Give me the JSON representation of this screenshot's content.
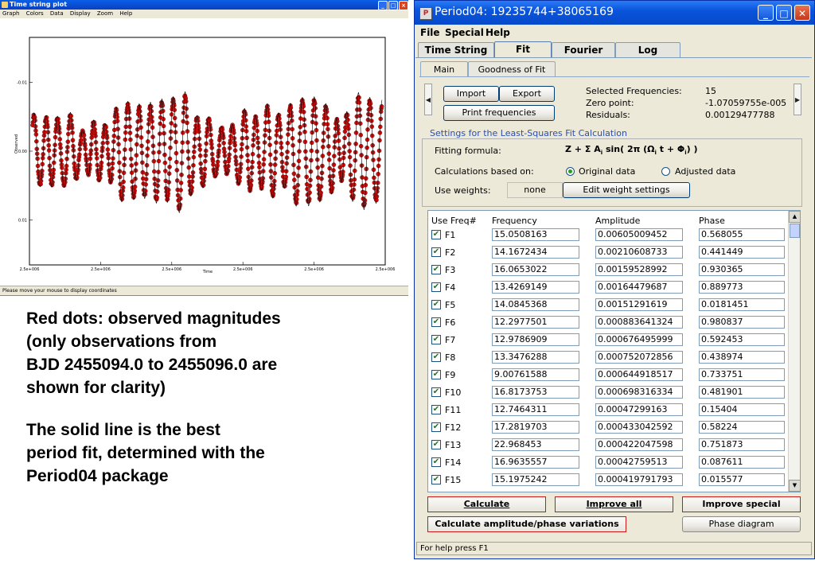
{
  "plot_window": {
    "title": "Time string plot",
    "menu": [
      "Graph",
      "Colors",
      "Data",
      "Display",
      "Zoom",
      "Help"
    ],
    "status": "Please move your mouse to display coordinates",
    "ylabel": "Observed",
    "xlabel": "Time",
    "yticks": [
      "-0.01",
      "0.00",
      "0.01"
    ],
    "xticks": [
      "2.5e+006",
      "2.5e+006",
      "2.5e+006",
      "2.5e+006",
      "2.5e+006",
      "2.5e+006"
    ],
    "dot_color": "#cc1111",
    "line_color": "#000000"
  },
  "chart_data": {
    "type": "scatter",
    "title": "",
    "xlabel": "Time",
    "ylabel": "Observed",
    "y_inverted": true,
    "ylim": [
      -0.0165,
      0.0165
    ],
    "ytick_values": [
      -0.01,
      0.0,
      0.01
    ],
    "xticks": [
      "2.5e+006",
      "2.5e+006",
      "2.5e+006",
      "2.5e+006",
      "2.5e+006",
      "2.5e+006"
    ],
    "series": [
      {
        "kind": "points",
        "color": "#cc1111"
      },
      {
        "kind": "line",
        "color": "#000000"
      }
    ],
    "fit_model": {
      "zero_point": -1.07059755e-05,
      "frequencies": [
        15.0508163,
        14.1672434,
        16.0653022,
        13.4269149,
        14.0845368,
        12.2977501,
        12.9786909,
        13.3476288,
        9.00761588,
        16.8173753,
        12.7464311,
        17.2819703,
        22.968453,
        16.9635557,
        15.1975242
      ],
      "amplitudes": [
        0.00605009452,
        0.00210608733,
        0.00159528992,
        0.00164479687,
        0.00151291619,
        0.000883641324,
        0.000676495999,
        0.000752072856,
        0.000644918517,
        0.000698316334,
        0.00047299163,
        0.000433042592,
        0.000422047598,
        0.00042759513,
        0.000419791793
      ],
      "phases": [
        0.568055,
        0.441449,
        0.930365,
        0.889773,
        0.0181451,
        0.980837,
        0.592453,
        0.438974,
        0.733751,
        0.481901,
        0.15404,
        0.58224,
        0.751873,
        0.087611,
        0.015577
      ],
      "time_span_days": 2.0
    }
  },
  "notes": {
    "p1_lines": [
      "Red dots: observed magnitudes",
      "(only observations from",
      "BJD 2455094.0 to 2455096.0 are",
      "shown for clarity)"
    ],
    "p2_lines": [
      "The solid line is the best",
      "period fit, determined with the",
      "Period04 package"
    ]
  },
  "period04": {
    "title": "Period04: 19235744+38065169",
    "menu": {
      "file": "File",
      "special": "Special",
      "help": "Help"
    },
    "tabs": {
      "time_string": "Time String",
      "fit": "Fit",
      "fourier": "Fourier",
      "log": "Log"
    },
    "subtabs": {
      "main": "Main",
      "goodness": "Goodness of Fit"
    },
    "buttons": {
      "import": "Import",
      "export": "Export",
      "print_freq": "Print frequencies",
      "edit_weights": "Edit weight settings"
    },
    "summary": {
      "sel_label": "Selected Frequencies:",
      "sel_value": "15",
      "zp_label": "Zero point:",
      "zp_value": "-1.07059755e-005",
      "res_label": "Residuals:",
      "res_value": "0.00129477788"
    },
    "settings": {
      "legend": "Settings for the Least-Squares Fit Calculation",
      "formula_label": "Fitting formula:",
      "calc_label": "Calculations based on:",
      "opt_original": "Original data",
      "opt_adjusted": "Adjusted data",
      "weights_label": "Use weights:",
      "weights_value": "none"
    },
    "table": {
      "headers": {
        "use": "Use Freq#",
        "freq": "Frequency",
        "amp": "Amplitude",
        "phase": "Phase"
      },
      "rows": [
        {
          "name": "F1",
          "freq": "15.0508163",
          "amp": "0.00605009452",
          "phase": "0.568055"
        },
        {
          "name": "F2",
          "freq": "14.1672434",
          "amp": "0.00210608733",
          "phase": "0.441449"
        },
        {
          "name": "F3",
          "freq": "16.0653022",
          "amp": "0.00159528992",
          "phase": "0.930365"
        },
        {
          "name": "F4",
          "freq": "13.4269149",
          "amp": "0.00164479687",
          "phase": "0.889773"
        },
        {
          "name": "F5",
          "freq": "14.0845368",
          "amp": "0.00151291619",
          "phase": "0.0181451"
        },
        {
          "name": "F6",
          "freq": "12.2977501",
          "amp": "0.000883641324",
          "phase": "0.980837"
        },
        {
          "name": "F7",
          "freq": "12.9786909",
          "amp": "0.000676495999",
          "phase": "0.592453"
        },
        {
          "name": "F8",
          "freq": "13.3476288",
          "amp": "0.000752072856",
          "phase": "0.438974"
        },
        {
          "name": "F9",
          "freq": "9.00761588",
          "amp": "0.000644918517",
          "phase": "0.733751"
        },
        {
          "name": "F10",
          "freq": "16.8173753",
          "amp": "0.000698316334",
          "phase": "0.481901"
        },
        {
          "name": "F11",
          "freq": "12.7464311",
          "amp": "0.00047299163",
          "phase": "0.15404"
        },
        {
          "name": "F12",
          "freq": "17.2819703",
          "amp": "0.000433042592",
          "phase": "0.58224"
        },
        {
          "name": "F13",
          "freq": "22.968453",
          "amp": "0.000422047598",
          "phase": "0.751873"
        },
        {
          "name": "F14",
          "freq": "16.9635557",
          "amp": "0.00042759513",
          "phase": "0.087611"
        },
        {
          "name": "F15",
          "freq": "15.1975242",
          "amp": "0.000419791793",
          "phase": "0.015577"
        }
      ]
    },
    "actions": {
      "calculate": "Calculate",
      "improve_all": "Improve all",
      "improve_special": "Improve special",
      "calc_amp": "Calculate amplitude/phase variations",
      "phase_diagram": "Phase diagram"
    },
    "status": "For help press F1",
    "accent_red": "#c81818"
  }
}
